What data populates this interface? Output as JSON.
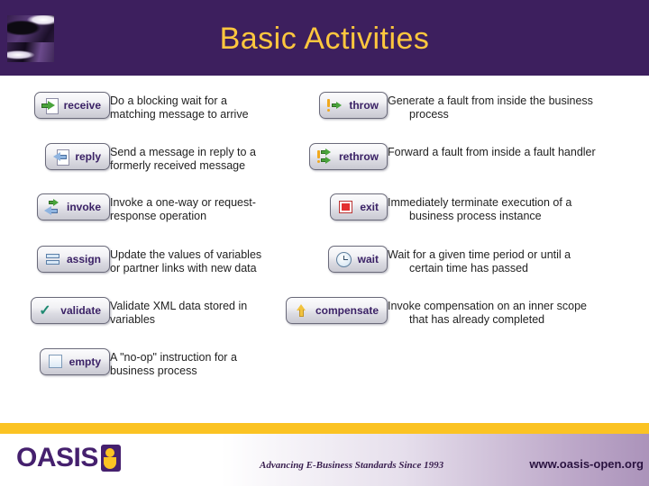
{
  "header": {
    "title": "Basic Activities",
    "logo_name": "abstract-swoosh-logo",
    "bg_color": "#3d1f5e",
    "title_color": "#ffc73e"
  },
  "columns": {
    "left": [
      {
        "label": "receive",
        "icon": "receive-arrow-icon",
        "desc_line1": "Do a blocking wait for a",
        "desc_line2": "matching message to arrive"
      },
      {
        "label": "reply",
        "icon": "reply-arrow-icon",
        "desc_line1": "Send a message in reply to a",
        "desc_line2": "formerly received message"
      },
      {
        "label": "invoke",
        "icon": "invoke-two-arrows-icon",
        "desc_line1": "Invoke a one-way or request-",
        "desc_line2": "response operation"
      },
      {
        "label": "assign",
        "icon": "assign-bars-icon",
        "desc_line1": "Update the values of variables",
        "desc_line2": "or partner links with new data"
      },
      {
        "label": "validate",
        "icon": "validate-check-icon",
        "desc_line1": "Validate XML data stored in",
        "desc_line2": "variables"
      },
      {
        "label": "empty",
        "icon": "empty-square-icon",
        "desc_line1": "A \"no-op\" instruction for a",
        "desc_line2": "business process"
      }
    ],
    "right": [
      {
        "label": "throw",
        "icon": "throw-fault-arrow-icon",
        "desc_line1": "Generate a fault from inside the business",
        "desc_line2": "process"
      },
      {
        "label": "rethrow",
        "icon": "rethrow-fault-arrows-icon",
        "desc_line1": "Forward a fault from inside a fault handler",
        "desc_line2": ""
      },
      {
        "label": "exit",
        "icon": "exit-stop-square-icon",
        "desc_line1": "Immediately terminate execution of a",
        "desc_line2": "business process instance"
      },
      {
        "label": "wait",
        "icon": "wait-clock-icon",
        "desc_line1": "Wait for a given time period or until a",
        "desc_line2": "certain time has passed"
      },
      {
        "label": "compensate",
        "icon": "compensate-up-arrow-icon",
        "desc_line1": "Invoke compensation on an inner scope",
        "desc_line2": "that has already completed"
      }
    ]
  },
  "footer": {
    "brand": "OASIS",
    "brand_mark": "oasis-glyph-icon",
    "tagline": "Advancing E-Business Standards Since 1993",
    "url": "www.oasis-open.org",
    "accent_color": "#fbc323",
    "brand_color": "#45206e"
  }
}
